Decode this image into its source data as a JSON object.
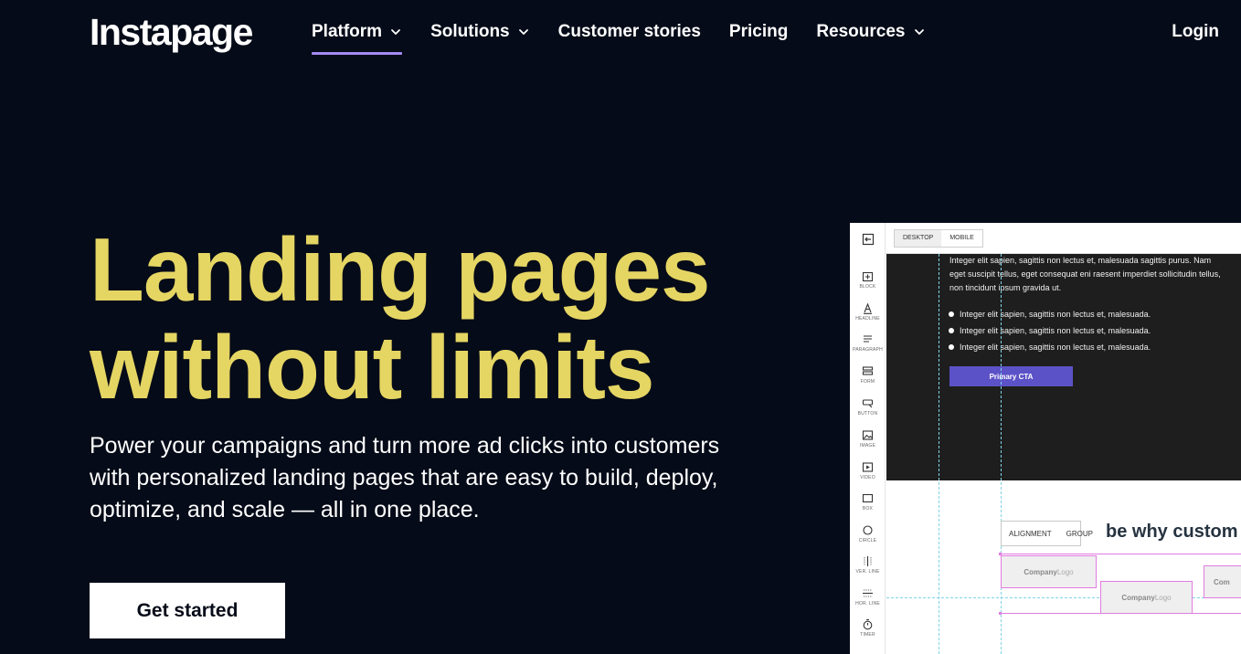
{
  "nav": {
    "logo": "Instapage",
    "items": [
      {
        "label": "Platform",
        "dropdown": true,
        "active": true
      },
      {
        "label": "Solutions",
        "dropdown": true,
        "active": false
      },
      {
        "label": "Customer stories",
        "dropdown": false,
        "active": false
      },
      {
        "label": "Pricing",
        "dropdown": false,
        "active": false
      },
      {
        "label": "Resources",
        "dropdown": true,
        "active": false
      }
    ],
    "login": "Login"
  },
  "hero": {
    "title_line1": "Landing pages",
    "title_line2": "without limits",
    "subtitle": "Power your campaigns and turn more ad clicks into customers with personalized landing pages that are easy to build, deploy, optimize, and scale — all in one place.",
    "cta": "Get started"
  },
  "editor": {
    "view_tabs": [
      "DESKTOP",
      "MOBILE"
    ],
    "tools": [
      "BLOCK",
      "HEADLINE",
      "PARAGRAPH",
      "FORM",
      "BUTTON",
      "IMAGE",
      "VIDEO",
      "BOX",
      "CIRCLE",
      "VER. LINE",
      "HOR. LINE",
      "TIMER"
    ],
    "paragraph": "Integer elit sapien, sagittis non lectus et, malesuada sagittis purus. Nam eget suscipit tellus, eget consequat eni raesent imperdiet sollicitudin tellus, non tincidunt ipsum gravida ut.",
    "bullets": [
      "Integer elit sapien, sagittis non lectus et, malesuada.",
      "Integer elit sapien, sagittis non lectus et, malesuada.",
      "Integer elit sapien, sagittis non lectus et, malesuada."
    ],
    "primary_cta": "Primary CTA",
    "alignment": "ALIGNMENT",
    "group": "GROUP",
    "section_heading": "be why custom",
    "logo_company": "Company",
    "logo_word": "Logo",
    "logo_partial": "Com"
  },
  "colors": {
    "background": "#050b18",
    "headline": "#e5d563",
    "nav_underline": "#a58af6",
    "primary_cta": "#5c52c7"
  }
}
